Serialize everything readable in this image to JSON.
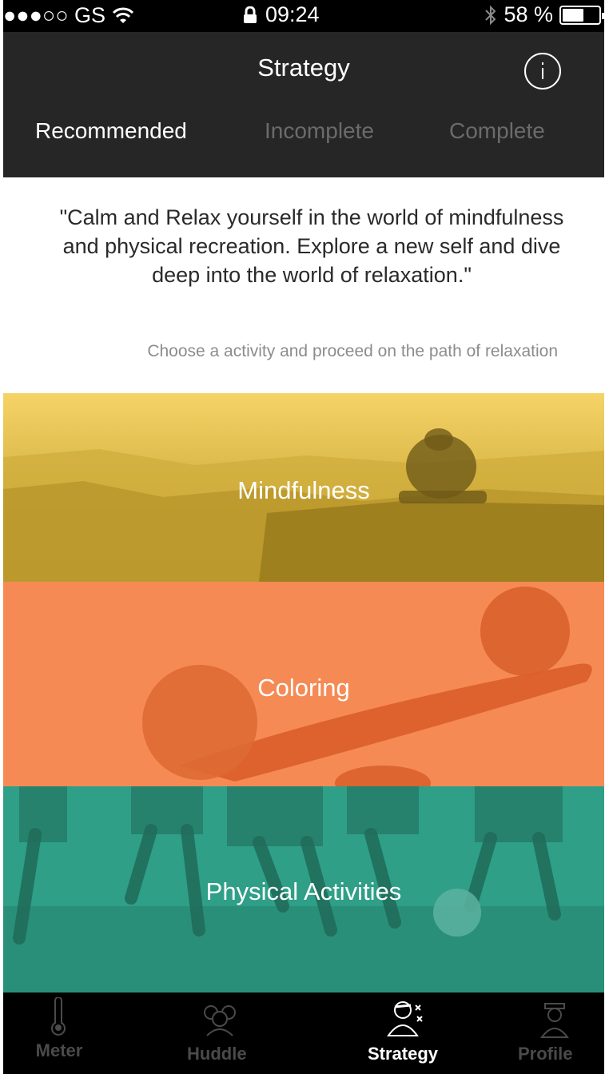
{
  "status_bar": {
    "carrier": "●●●○○ GS",
    "time": "09:24",
    "battery_percent": "58 %",
    "battery_level": 0.58
  },
  "header": {
    "title": "Strategy",
    "info_icon": "info-icon"
  },
  "tabs": [
    {
      "label": "Recommended",
      "active": true
    },
    {
      "label": "Incomplete",
      "active": false
    },
    {
      "label": "Complete",
      "active": false
    }
  ],
  "intro": {
    "quote": "\"Calm and Relax yourself in the world of mindfulness and physical recreation. Explore a new self and dive deep into the world of relaxation.\"",
    "hint": "Choose a activity and proceed on the path of relaxation"
  },
  "activities": [
    {
      "label": "Mindfulness",
      "color": "#d6b43f"
    },
    {
      "label": "Coloring",
      "color": "#f58a55"
    },
    {
      "label": "Physical Activities",
      "color": "#2f9f87"
    }
  ],
  "tab_bar": {
    "items": [
      {
        "label": "Meter",
        "icon": "thermometer-icon",
        "active": false
      },
      {
        "label": "Huddle",
        "icon": "group-icon",
        "active": false
      },
      {
        "label": "Strategy",
        "icon": "coach-strategy-icon",
        "active": true
      },
      {
        "label": "Profile",
        "icon": "officer-profile-icon",
        "active": false
      }
    ]
  }
}
